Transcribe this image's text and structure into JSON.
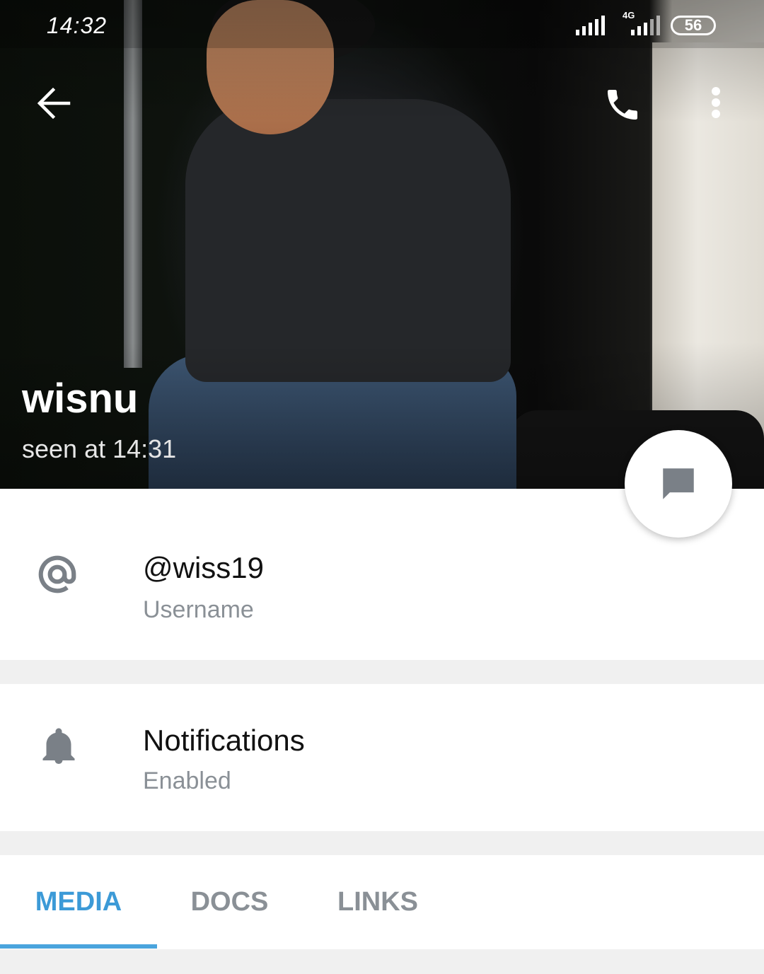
{
  "status_bar": {
    "time": "14:32",
    "network": "4G",
    "battery": "56"
  },
  "toolbar": {
    "back_icon": "arrow-left-icon",
    "call_icon": "phone-icon",
    "menu_icon": "more-vertical-icon"
  },
  "profile": {
    "name": "wisnu",
    "last_seen": "seen at 14:31"
  },
  "fab": {
    "icon": "message-icon"
  },
  "username_section": {
    "icon": "at-sign-icon",
    "value": "@wiss19",
    "label": "Username"
  },
  "notifications_section": {
    "icon": "bell-icon",
    "title": "Notifications",
    "status": "Enabled"
  },
  "tabs": [
    {
      "label": "MEDIA",
      "active": true
    },
    {
      "label": "DOCS",
      "active": false
    },
    {
      "label": "LINKS",
      "active": false
    }
  ],
  "colors": {
    "accent": "#3c9ad7",
    "secondary_text": "#8a9096",
    "icon_gray": "#7a8087"
  }
}
